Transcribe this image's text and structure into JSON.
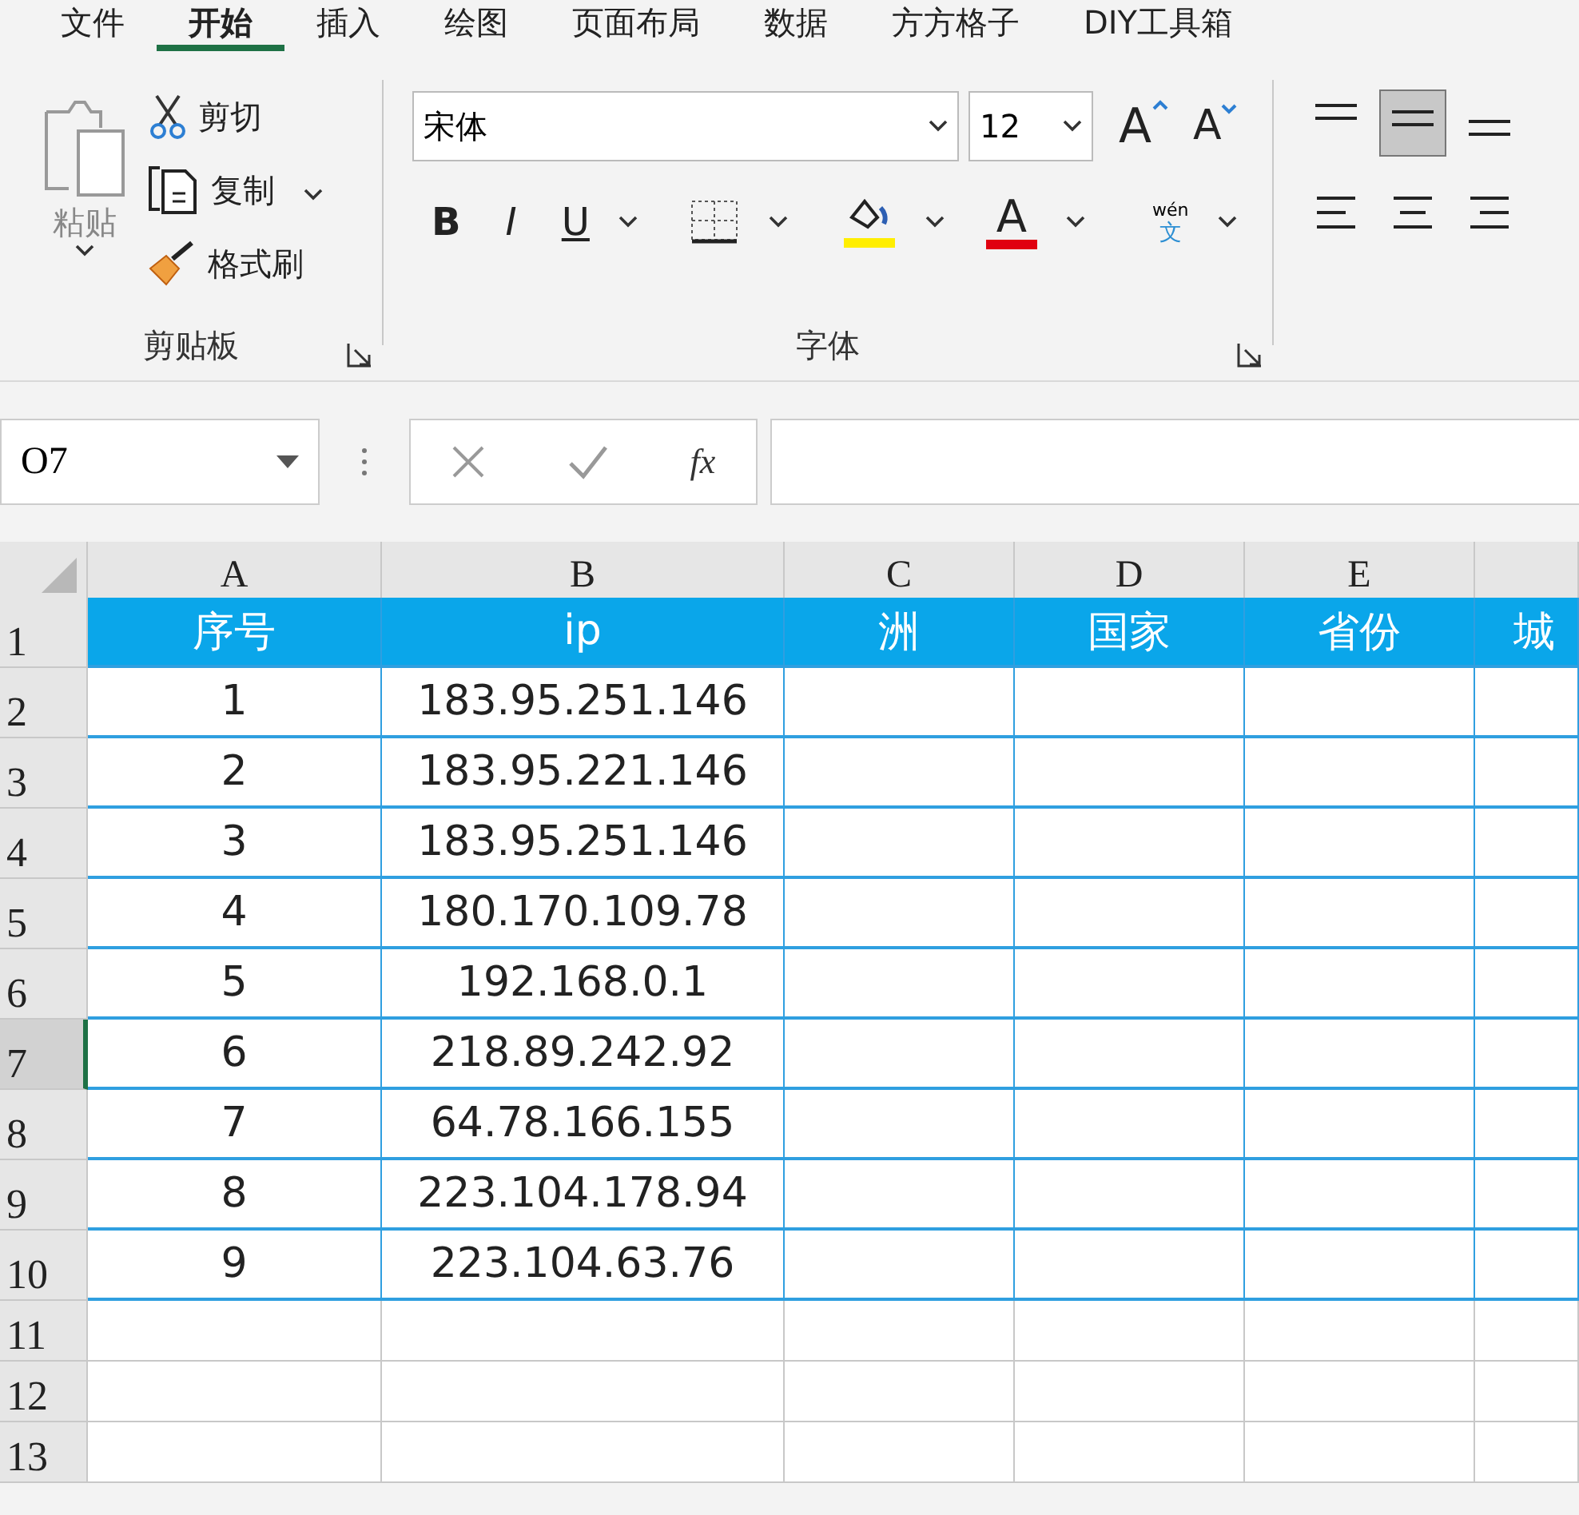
{
  "tabs": [
    {
      "label": "文件",
      "selected": false
    },
    {
      "label": "开始",
      "selected": true
    },
    {
      "label": "插入",
      "selected": false
    },
    {
      "label": "绘图",
      "selected": false
    },
    {
      "label": "页面布局",
      "selected": false
    },
    {
      "label": "数据",
      "selected": false
    },
    {
      "label": "方方格子",
      "selected": false
    },
    {
      "label": "DIY工具箱",
      "selected": false
    }
  ],
  "clipboard": {
    "paste": "粘贴",
    "cut": "剪切",
    "copy": "复制",
    "format_painter": "格式刷",
    "group_label": "剪贴板"
  },
  "font": {
    "name": "宋体",
    "size": "12",
    "grow": "A",
    "shrink": "A",
    "bold": "B",
    "italic": "I",
    "underline": "U",
    "font_color": "A",
    "phonetic_top": "wén",
    "phonetic_bottom": "文",
    "group_label": "字体"
  },
  "alignment": {
    "vertical": [
      {
        "kind": "top",
        "selected": false
      },
      {
        "kind": "middle",
        "selected": true
      },
      {
        "kind": "bottom",
        "selected": false
      }
    ],
    "horizontal": [
      {
        "kind": "left"
      },
      {
        "kind": "center"
      },
      {
        "kind": "right"
      }
    ]
  },
  "formula_bar": {
    "name_box": "O7",
    "fx": "fx"
  },
  "sheet": {
    "columns": [
      "A",
      "B",
      "C",
      "D",
      "E",
      ""
    ],
    "rows": [
      {
        "number": "1",
        "selected": false,
        "header": true,
        "cells": [
          "序号",
          "ip",
          "洲",
          "国家",
          "省份",
          "城"
        ]
      },
      {
        "number": "2",
        "selected": false,
        "header": false,
        "cells": [
          "1",
          "183.95.251.146"
        ]
      },
      {
        "number": "3",
        "selected": false,
        "header": false,
        "cells": [
          "2",
          "183.95.221.146"
        ]
      },
      {
        "number": "4",
        "selected": false,
        "header": false,
        "cells": [
          "3",
          "183.95.251.146"
        ]
      },
      {
        "number": "5",
        "selected": false,
        "header": false,
        "cells": [
          "4",
          "180.170.109.78"
        ]
      },
      {
        "number": "6",
        "selected": false,
        "header": false,
        "cells": [
          "5",
          "192.168.0.1"
        ]
      },
      {
        "number": "7",
        "selected": true,
        "header": false,
        "cells": [
          "6",
          "218.89.242.92"
        ]
      },
      {
        "number": "8",
        "selected": false,
        "header": false,
        "cells": [
          "7",
          "64.78.166.155"
        ]
      },
      {
        "number": "9",
        "selected": false,
        "header": false,
        "cells": [
          "8",
          "223.104.178.94"
        ]
      },
      {
        "number": "10",
        "selected": false,
        "header": false,
        "cells": [
          "9",
          "223.104.63.76"
        ]
      },
      {
        "number": "11",
        "selected": false,
        "header": false,
        "cells": []
      },
      {
        "number": "12",
        "selected": false,
        "header": false,
        "cells": []
      },
      {
        "number": "13",
        "selected": false,
        "header": false,
        "cells": []
      }
    ]
  }
}
